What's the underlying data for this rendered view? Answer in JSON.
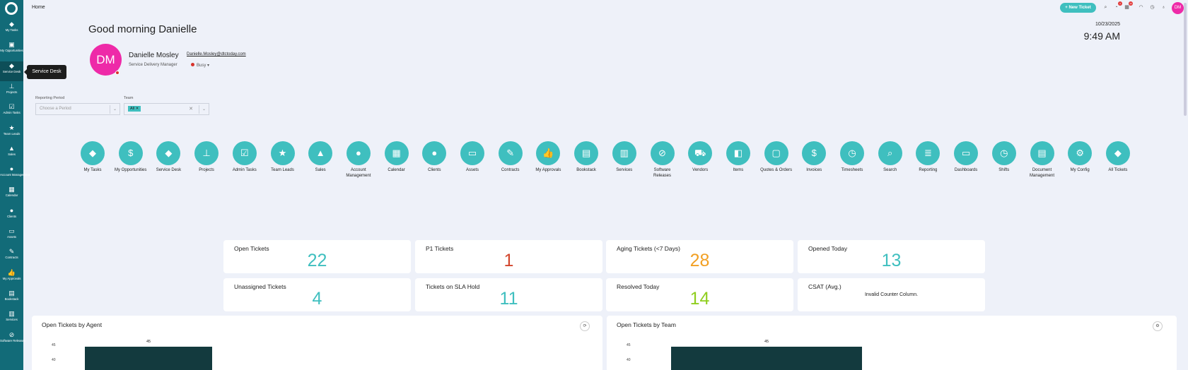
{
  "sidebar": {
    "items": [
      {
        "label": "My Tasks",
        "icon": "ticket-icon",
        "glyph": "◆"
      },
      {
        "label": "My Opportunities",
        "icon": "money-icon",
        "glyph": "▣"
      },
      {
        "label": "Service Desk",
        "icon": "ticket-icon",
        "glyph": "◆"
      },
      {
        "label": "Projects",
        "icon": "sitemap-icon",
        "glyph": "⊥"
      },
      {
        "label": "Admin Tasks",
        "icon": "checkbox-icon",
        "glyph": "☑"
      },
      {
        "label": "Team Leads",
        "icon": "star-icon",
        "glyph": "★"
      },
      {
        "label": "Sales",
        "icon": "chart-icon",
        "glyph": "▲"
      },
      {
        "label": "Account Management",
        "icon": "users-icon",
        "glyph": "●"
      },
      {
        "label": "Calendar",
        "icon": "calendar-icon",
        "glyph": "▦"
      },
      {
        "label": "Clients",
        "icon": "person-icon",
        "glyph": "●"
      },
      {
        "label": "Assets",
        "icon": "laptop-icon",
        "glyph": "▭"
      },
      {
        "label": "Contracts",
        "icon": "contract-icon",
        "glyph": "✎"
      },
      {
        "label": "My Approvals",
        "icon": "thumbs-up-icon",
        "glyph": "👍"
      },
      {
        "label": "Bookstack",
        "icon": "book-icon",
        "glyph": "▤"
      },
      {
        "label": "Services",
        "icon": "services-icon",
        "glyph": "▥"
      },
      {
        "label": "Software Releases",
        "icon": "disc-icon",
        "glyph": "⊘"
      }
    ],
    "tooltip": "Service Desk"
  },
  "header": {
    "breadcrumb": "Home",
    "new_ticket_label": "+ New Ticket",
    "badges": [
      "4",
      "12"
    ],
    "user_initials": "DM"
  },
  "greeting": "Good morning Danielle",
  "datetime": {
    "date": "10/23/2025",
    "time": "9:49 AM"
  },
  "user": {
    "initials": "DM",
    "name": "Danielle Mosley",
    "email": "Danielle.Mosley@dtctoday.com",
    "role": "Service Delivery Manager",
    "status": "Busy"
  },
  "filters": {
    "period_label": "Reporting Period",
    "period_placeholder": "Choose a Period",
    "team_label": "Team",
    "team_value": "All"
  },
  "tiles": [
    {
      "label": "My Tasks",
      "icon": "ticket-icon",
      "glyph": "◆"
    },
    {
      "label": "My Opportunities",
      "icon": "money-icon",
      "glyph": "$"
    },
    {
      "label": "Service Desk",
      "icon": "ticket-icon",
      "glyph": "◆"
    },
    {
      "label": "Projects",
      "icon": "sitemap-icon",
      "glyph": "⊥"
    },
    {
      "label": "Admin Tasks",
      "icon": "checkbox-icon",
      "glyph": "☑"
    },
    {
      "label": "Team Leads",
      "icon": "star-icon",
      "glyph": "★"
    },
    {
      "label": "Sales",
      "icon": "chart-icon",
      "glyph": "▲"
    },
    {
      "label": "Account Management",
      "icon": "users-icon",
      "glyph": "●"
    },
    {
      "label": "Calendar",
      "icon": "calendar-icon",
      "glyph": "▦"
    },
    {
      "label": "Clients",
      "icon": "person-icon",
      "glyph": "●"
    },
    {
      "label": "Assets",
      "icon": "laptop-icon",
      "glyph": "▭"
    },
    {
      "label": "Contracts",
      "icon": "contract-icon",
      "glyph": "✎"
    },
    {
      "label": "My Approvals",
      "icon": "thumbs-up-icon",
      "glyph": "👍"
    },
    {
      "label": "Bookstack",
      "icon": "book-icon",
      "glyph": "▤"
    },
    {
      "label": "Services",
      "icon": "services-icon",
      "glyph": "▥"
    },
    {
      "label": "Software Releases",
      "icon": "disc-icon",
      "glyph": "⊘"
    },
    {
      "label": "Vendors",
      "icon": "truck-icon",
      "glyph": "⛟"
    },
    {
      "label": "Items",
      "icon": "box-icon",
      "glyph": "◧"
    },
    {
      "label": "Quotes & Orders",
      "icon": "document-icon",
      "glyph": "▢"
    },
    {
      "label": "Invoices",
      "icon": "money-bag-icon",
      "glyph": "$"
    },
    {
      "label": "Timesheets",
      "icon": "clock-icon",
      "glyph": "◷"
    },
    {
      "label": "Search",
      "icon": "search-icon",
      "glyph": "⌕"
    },
    {
      "label": "Reporting",
      "icon": "report-icon",
      "glyph": "≣"
    },
    {
      "label": "Dashboards",
      "icon": "monitor-icon",
      "glyph": "▭"
    },
    {
      "label": "Shifts",
      "icon": "clock-icon",
      "glyph": "◷"
    },
    {
      "label": "Document Management",
      "icon": "documents-icon",
      "glyph": "▤"
    },
    {
      "label": "My Config",
      "icon": "gear-icon",
      "glyph": "⚙"
    },
    {
      "label": "All Tickets",
      "icon": "ticket-icon",
      "glyph": "◆"
    }
  ],
  "cards": [
    {
      "title": "Open Tickets",
      "value": "22",
      "color": "#3fbfbf"
    },
    {
      "title": "P1 Tickets",
      "value": "1",
      "color": "#d2452b"
    },
    {
      "title": "Aging Tickets (<7 Days)",
      "value": "28",
      "color": "#f2a024"
    },
    {
      "title": "Opened Today",
      "value": "13",
      "color": "#3fbfbf"
    },
    {
      "title": "Unassigned Tickets",
      "value": "4",
      "color": "#3fbfbf"
    },
    {
      "title": "Tickets on SLA Hold",
      "value": "11",
      "color": "#3fbfbf"
    },
    {
      "title": "Resolved Today",
      "value": "14",
      "color": "#8fce1e"
    },
    {
      "title": "CSAT (Avg.)",
      "note": "Invalid Counter Column."
    }
  ],
  "panels": [
    {
      "title": "Open Tickets by Agent",
      "ticks": [
        "45",
        "40"
      ],
      "bar_value": 45
    },
    {
      "title": "Open Tickets by Team",
      "ticks": [
        "45",
        "40"
      ],
      "bar_value": 45
    }
  ]
}
